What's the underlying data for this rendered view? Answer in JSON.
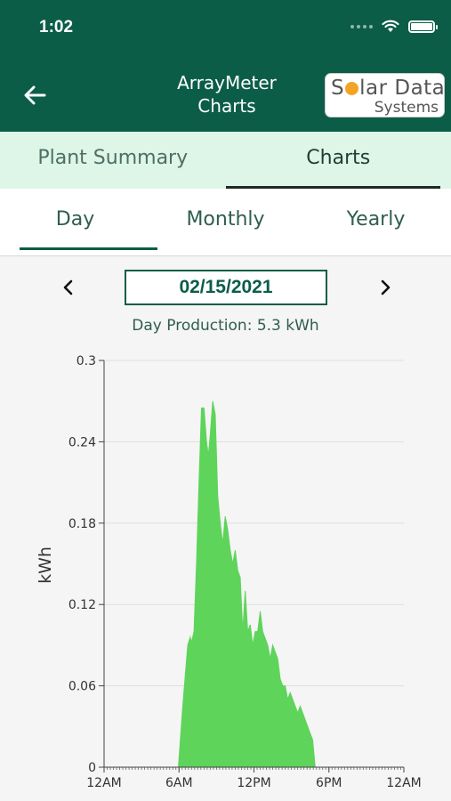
{
  "status_bar": {
    "time": "1:02"
  },
  "header": {
    "title_line1": "ArrayMeter",
    "title_line2": "Charts",
    "logo": {
      "line1_pre": "S",
      "line1_post": "lar Data",
      "line2": "Systems"
    }
  },
  "tabs": [
    {
      "label": "Plant Summary",
      "active": false
    },
    {
      "label": "Charts",
      "active": true
    }
  ],
  "subtabs": [
    {
      "label": "Day",
      "active": true
    },
    {
      "label": "Monthly",
      "active": false
    },
    {
      "label": "Yearly",
      "active": false
    }
  ],
  "date": "02/15/2021",
  "production": "Day Production: 5.3 kWh",
  "colors": {
    "brand": "#0b5d47",
    "series": "#5ed45a",
    "tab_bg": "#ddf6e8"
  },
  "chart_data": {
    "type": "area",
    "ylabel": "kWh",
    "ylim": [
      0,
      0.3
    ],
    "yticks": [
      "0",
      "0.06",
      "0.12",
      "0.18",
      "0.24",
      "0.3"
    ],
    "xlim": [
      0,
      24
    ],
    "xticks": [
      "12AM",
      "6AM",
      "12PM",
      "6PM",
      "12AM"
    ],
    "x_unit": "hour of day",
    "grid": true,
    "series": [
      {
        "x": [
          5.95,
          6.3,
          6.7,
          6.9,
          7.0,
          7.2,
          7.4,
          7.6,
          7.8,
          8.0,
          8.2,
          8.35,
          8.5,
          8.7,
          8.9,
          9.1,
          9.3,
          9.5,
          9.7,
          9.9,
          10.1,
          10.3,
          10.5,
          10.7,
          10.9,
          11.1,
          11.3,
          11.5,
          11.7,
          11.9,
          12.1,
          12.3,
          12.5,
          12.7,
          12.9,
          13.1,
          13.3,
          13.5,
          13.7,
          13.9,
          14.1,
          14.3,
          14.5,
          14.7,
          14.9,
          15.1,
          15.3,
          15.5,
          15.7,
          15.9,
          16.1,
          16.3,
          16.5,
          16.7,
          16.9,
          17.1,
          17.3,
          17.5
        ],
        "values": [
          0,
          0.045,
          0.09,
          0.096,
          0.092,
          0.1,
          0.15,
          0.21,
          0.265,
          0.265,
          0.24,
          0.23,
          0.245,
          0.27,
          0.26,
          0.2,
          0.18,
          0.165,
          0.185,
          0.175,
          0.16,
          0.15,
          0.16,
          0.145,
          0.14,
          0.1,
          0.13,
          0.1,
          0.105,
          0.09,
          0.1,
          0.1,
          0.115,
          0.1,
          0.095,
          0.09,
          0.08,
          0.09,
          0.085,
          0.08,
          0.065,
          0.06,
          0.06,
          0.05,
          0.055,
          0.05,
          0.045,
          0.04,
          0.045,
          0.04,
          0.035,
          0.03,
          0.025,
          0.02,
          0.0,
          0.0,
          0.0,
          0.0
        ]
      }
    ]
  }
}
